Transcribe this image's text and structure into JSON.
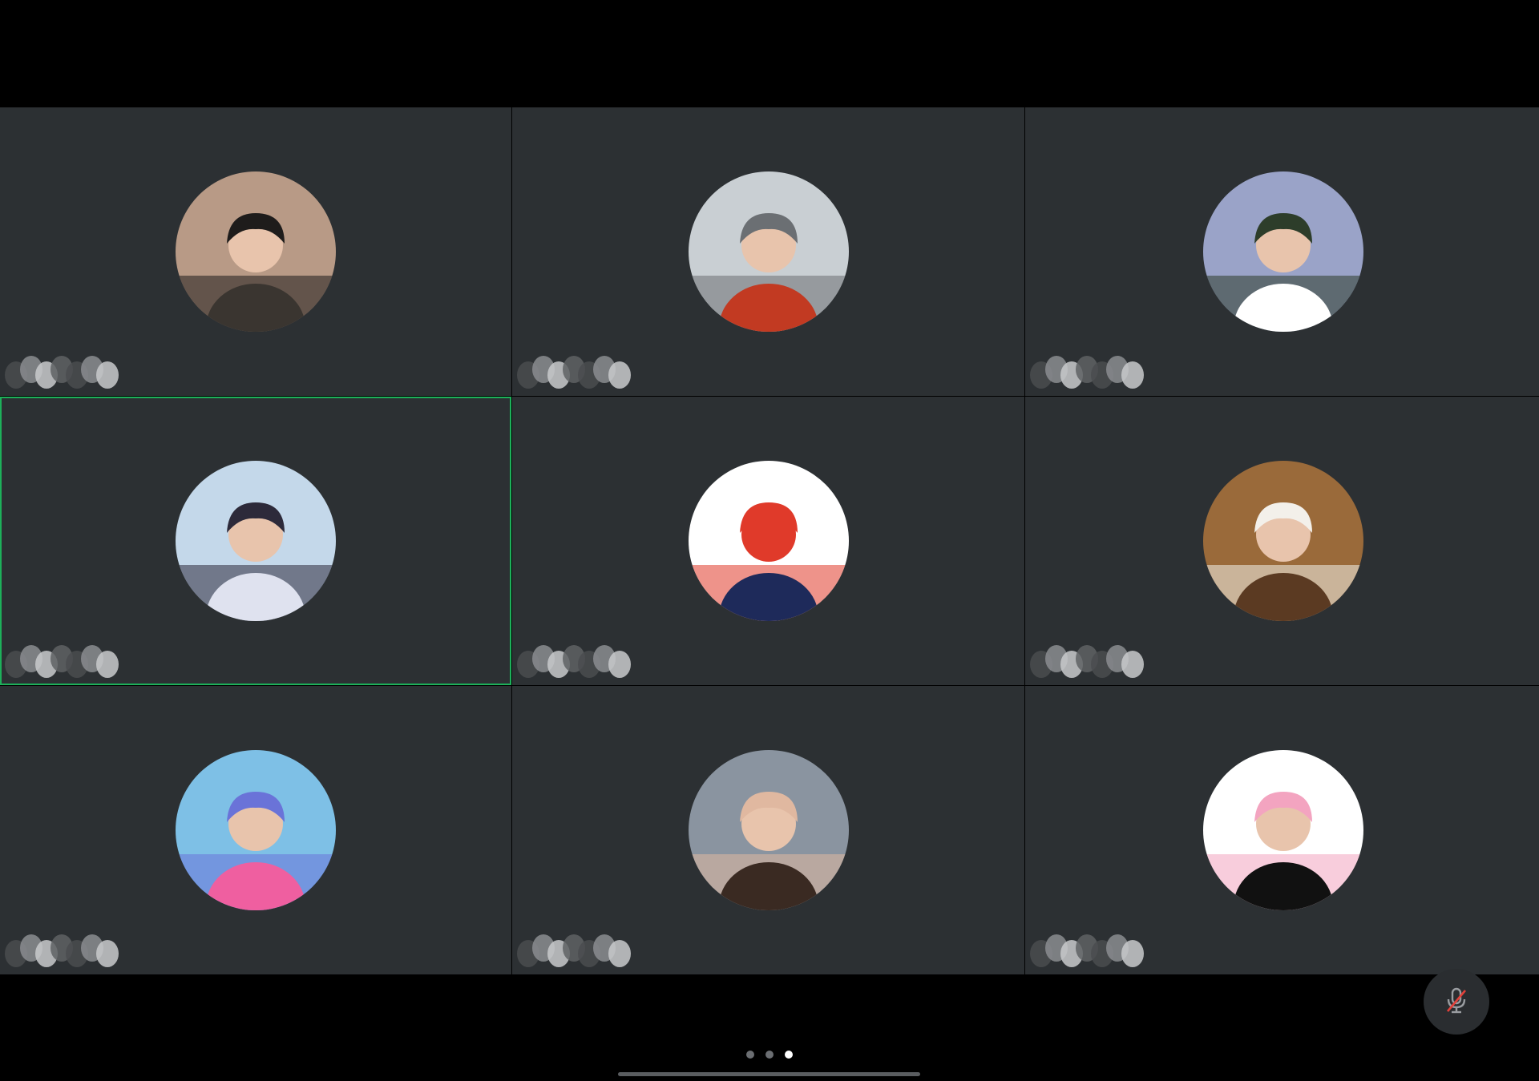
{
  "meeting": {
    "participants": [
      {
        "id": "p1",
        "name": "",
        "avatar": "person-hoodie-headphones",
        "colors": [
          "#b89a86",
          "#3a3530",
          "#1e1c1b"
        ],
        "active_speaker": false
      },
      {
        "id": "p2",
        "name": "",
        "avatar": "painting-woman-red-headscarf",
        "colors": [
          "#c9cfd3",
          "#c23a22",
          "#6b6f73"
        ],
        "active_speaker": false
      },
      {
        "id": "p3",
        "name": "",
        "avatar": "man-white-shirt-by-sea",
        "colors": [
          "#9aa3c8",
          "#ffffff",
          "#2d3d2a"
        ],
        "active_speaker": false
      },
      {
        "id": "p4",
        "name": "",
        "avatar": "anime-swordsman-umbrella",
        "colors": [
          "#c4d8ea",
          "#dfe2ef",
          "#2d2a3a"
        ],
        "active_speaker": true
      },
      {
        "id": "p5",
        "name": "",
        "avatar": "cartoon-racing-driver",
        "colors": [
          "#ffffff",
          "#1e2a5a",
          "#e03a2a"
        ],
        "active_speaker": false
      },
      {
        "id": "p6",
        "name": "",
        "avatar": "girl-striped-cardigan",
        "colors": [
          "#9a6a3a",
          "#5b3a22",
          "#f3f0ea"
        ],
        "active_speaker": false
      },
      {
        "id": "p7",
        "name": "",
        "avatar": "cartoon-girl-sunhat",
        "colors": [
          "#7ec0e6",
          "#ef5fa0",
          "#6a73d8"
        ],
        "active_speaker": false
      },
      {
        "id": "p8",
        "name": "",
        "avatar": "smiling-girl-portrait",
        "colors": [
          "#8a94a0",
          "#3a2a22",
          "#e0b8a0"
        ],
        "active_speaker": false
      },
      {
        "id": "p9",
        "name": "",
        "avatar": "anime-girl-wink",
        "colors": [
          "#ffffff",
          "#111111",
          "#f3a4c0"
        ],
        "active_speaker": false
      }
    ]
  },
  "controls": {
    "mic_state": "muted",
    "mic_icon": "mic-off-icon"
  },
  "pagination": {
    "pages": 3,
    "current": 3
  }
}
